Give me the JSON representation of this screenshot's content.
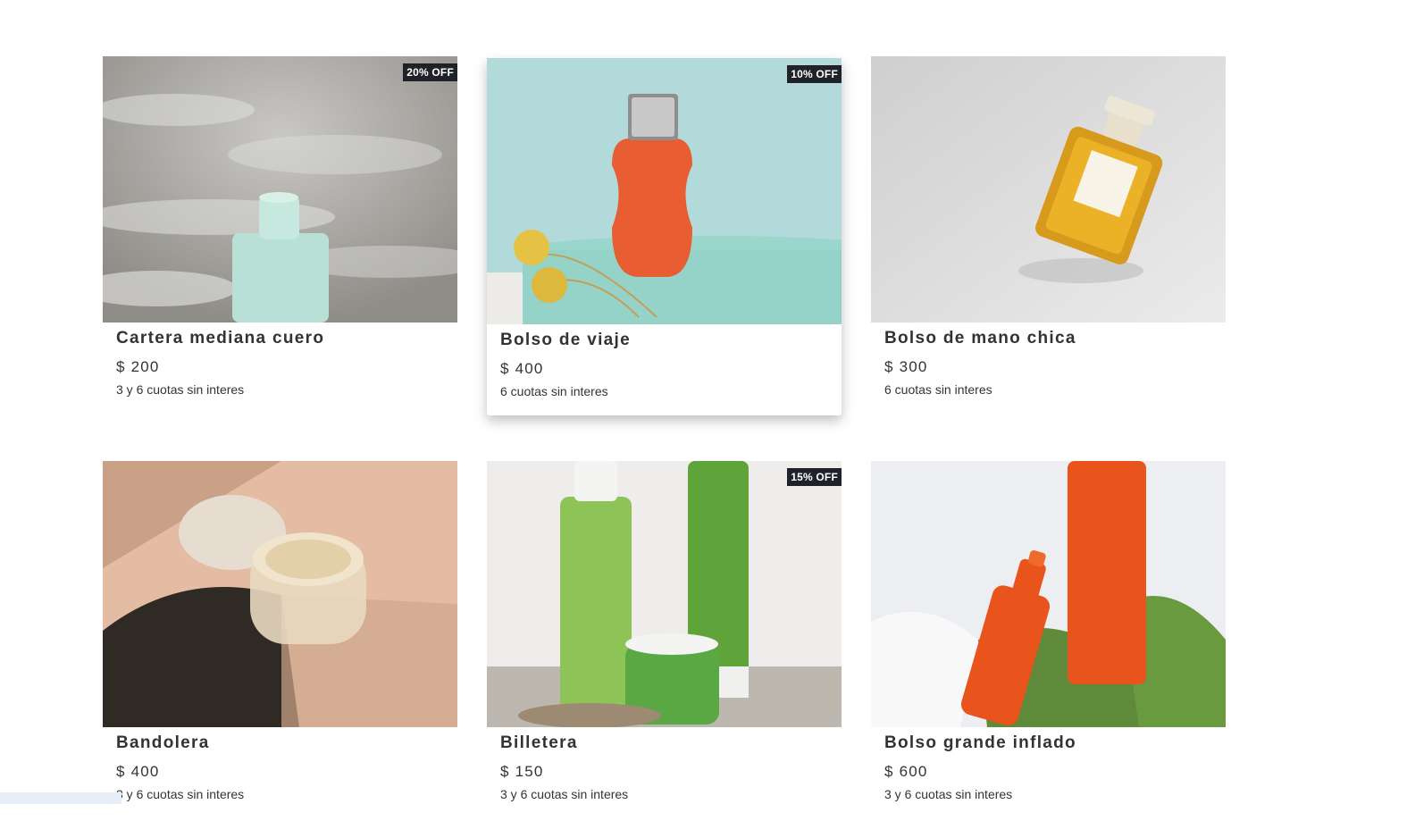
{
  "products": [
    {
      "title": "Cartera mediana cuero",
      "price": "$ 200",
      "installments": "3 y 6 cuotas sin interes",
      "discount": "20% OFF",
      "image_subject": "aqua-perfume-bottle-on-sand-photo"
    },
    {
      "title": "Bolso de viaje",
      "price": "$ 400",
      "installments": "6 cuotas sin interes",
      "discount": "10% OFF",
      "image_subject": "orange-perfume-bottle-photo"
    },
    {
      "title": "Bolso de mano chica",
      "price": "$ 300",
      "installments": "6 cuotas sin interes",
      "discount": "",
      "image_subject": "chanel-perfume-bottle-photo"
    },
    {
      "title": "Bandolera",
      "price": "$ 400",
      "installments": "3 y 6 cuotas sin interes",
      "discount": "",
      "image_subject": "cosmetic-jar-photo"
    },
    {
      "title": "Billetera",
      "price": "$ 150",
      "installments": "3 y 6 cuotas sin interes",
      "discount": "15% OFF",
      "image_subject": "green-skincare-products-photo"
    },
    {
      "title": "Bolso grande inflado",
      "price": "$ 600",
      "installments": "3 y 6 cuotas sin interes",
      "discount": "",
      "image_subject": "orange-skincare-products-photo"
    }
  ],
  "colors": {
    "badge_bg": "#1f2228",
    "badge_text": "#ffffff",
    "text": "#333333",
    "page_bg": "#ffffff"
  }
}
